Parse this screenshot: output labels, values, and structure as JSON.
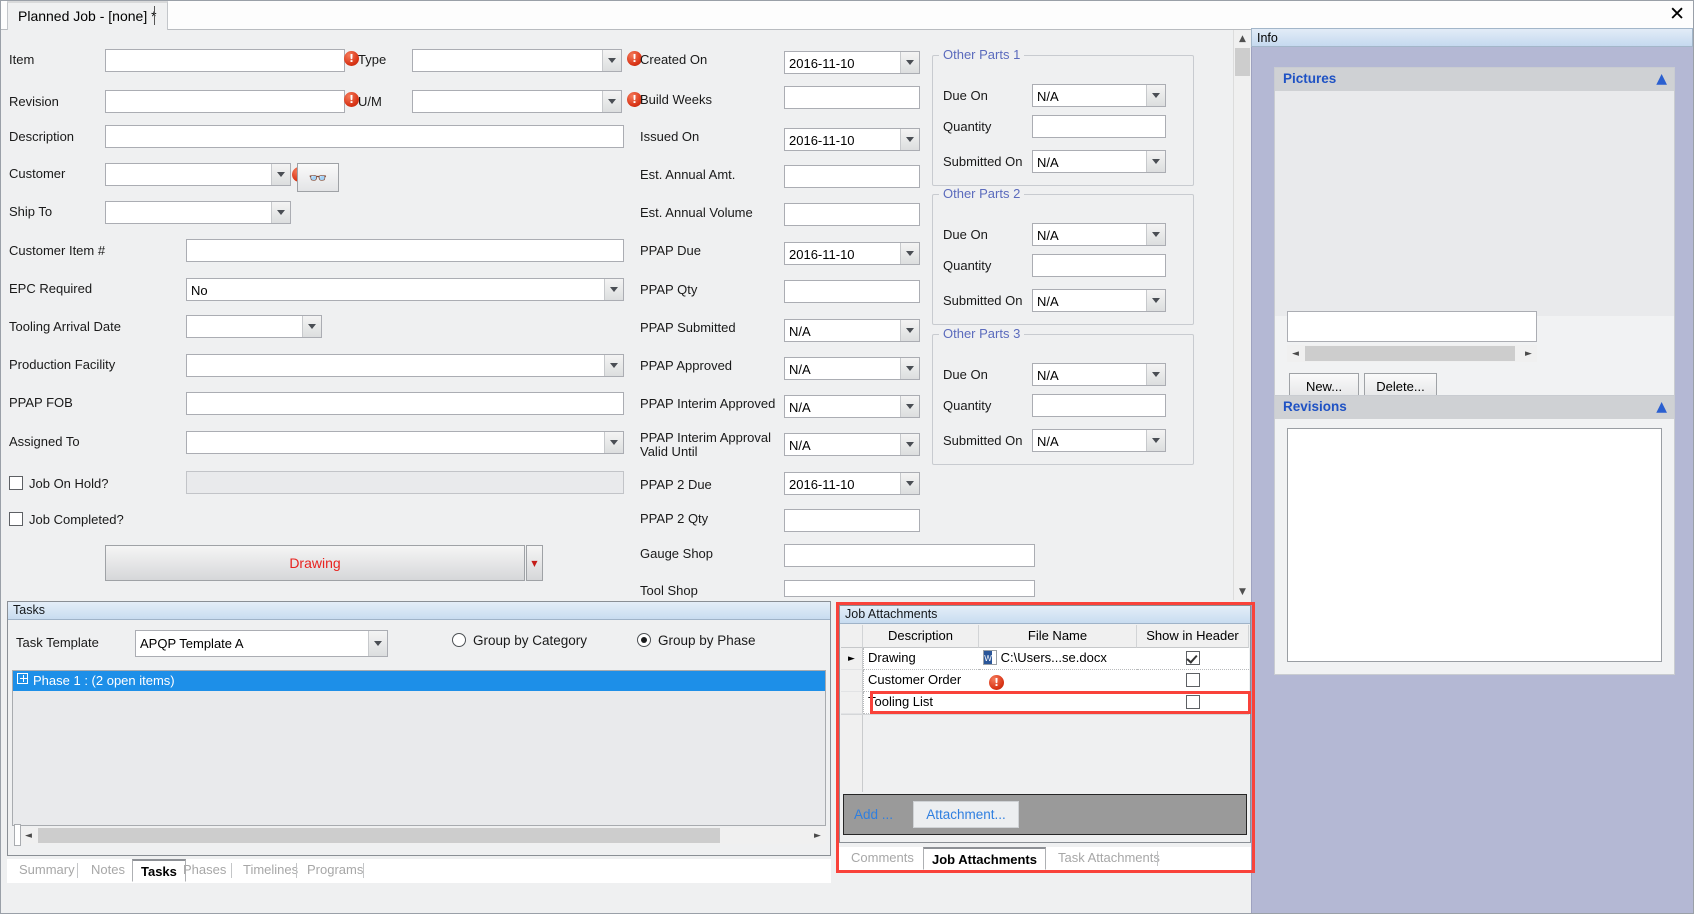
{
  "window": {
    "tab_title": "Planned Job - [none] *",
    "close_icon": "close-icon"
  },
  "left_form": {
    "fields": [
      {
        "label": "Item",
        "value": "",
        "type": "textbox",
        "warn": true,
        "warn_label": "Type"
      },
      {
        "label": "Revision",
        "value": "",
        "type": "textbox",
        "secondary_label": "U/M"
      },
      {
        "label": "Description",
        "value": "",
        "type": "textbox"
      },
      {
        "label": "Customer",
        "value": "",
        "type": "combo"
      },
      {
        "label": "Ship To",
        "value": "",
        "type": "combo"
      },
      {
        "label": "Customer Item #",
        "value": "",
        "type": "textbox"
      },
      {
        "label": "EPC Required",
        "value": "No",
        "type": "combo"
      },
      {
        "label": "Tooling Arrival Date",
        "value": "",
        "type": "combo"
      },
      {
        "label": "Production Facility",
        "value": "",
        "type": "combo"
      },
      {
        "label": "PPAP FOB",
        "value": "",
        "type": "textbox"
      },
      {
        "label": "Assigned To",
        "value": "",
        "type": "combo"
      }
    ],
    "type_field_value": "",
    "um_field_value": "",
    "search_button_icon": "binoculars-icon",
    "checkboxes": [
      {
        "label": "Job On Hold?",
        "checked": false
      },
      {
        "label": "Job Completed?",
        "checked": false
      }
    ],
    "hold_note_value": "",
    "drawing_button": {
      "label": "Drawing",
      "color": "#e8231f",
      "dropdown_icon": "chevron-down-icon"
    }
  },
  "mid_form": {
    "fields": [
      {
        "label": "Created On",
        "value": "2016-11-10",
        "type": "combo",
        "warn": true
      },
      {
        "label": "Build Weeks",
        "value": "",
        "type": "textbox",
        "warn": true
      },
      {
        "label": "Issued On",
        "value": "2016-11-10",
        "type": "combo"
      },
      {
        "label": "Est. Annual Amt.",
        "value": "",
        "type": "textbox"
      },
      {
        "label": "Est. Annual Volume",
        "value": "",
        "type": "textbox"
      },
      {
        "label": "PPAP Due",
        "value": "2016-11-10",
        "type": "combo"
      },
      {
        "label": "PPAP Qty",
        "value": "",
        "type": "textbox"
      },
      {
        "label": "PPAP Submitted",
        "value": "N/A",
        "type": "combo"
      },
      {
        "label": "PPAP Approved",
        "value": "N/A",
        "type": "combo"
      },
      {
        "label": "PPAP Interim Approved",
        "value": "N/A",
        "type": "combo"
      },
      {
        "label": "PPAP Interim Approval Valid Until",
        "value": "N/A",
        "type": "combo"
      },
      {
        "label": "PPAP 2 Due",
        "value": "2016-11-10",
        "type": "combo"
      },
      {
        "label": "PPAP 2 Qty",
        "value": "",
        "type": "textbox"
      },
      {
        "label": "Gauge Shop",
        "value": "",
        "type": "textbox"
      },
      {
        "label": "Tool Shop",
        "value": "",
        "type": "textbox"
      }
    ]
  },
  "other_parts": [
    {
      "title": "Other Parts 1",
      "rows": [
        {
          "label": "Due On",
          "value": "N/A",
          "type": "combo"
        },
        {
          "label": "Quantity",
          "value": "",
          "type": "textbox"
        },
        {
          "label": "Submitted On",
          "value": "N/A",
          "type": "combo"
        }
      ]
    },
    {
      "title": "Other Parts 2",
      "rows": [
        {
          "label": "Due On",
          "value": "N/A",
          "type": "combo"
        },
        {
          "label": "Quantity",
          "value": "",
          "type": "textbox"
        },
        {
          "label": "Submitted On",
          "value": "N/A",
          "type": "combo"
        }
      ]
    },
    {
      "title": "Other Parts 3",
      "rows": [
        {
          "label": "Due On",
          "value": "N/A",
          "type": "combo"
        },
        {
          "label": "Quantity",
          "value": "",
          "type": "textbox"
        },
        {
          "label": "Submitted On",
          "value": "N/A",
          "type": "combo"
        }
      ]
    }
  ],
  "info_panel": {
    "caption": "Info",
    "pictures": {
      "title": "Pictures",
      "collapse_icon": "chevron-up-icon",
      "caption_value": "",
      "nav_prev_icon": "chevron-left-icon",
      "nav_next_icon": "chevron-right-icon",
      "new_button": "New...",
      "delete_button": "Delete..."
    },
    "revisions": {
      "title": "Revisions",
      "collapse_icon": "chevron-up-icon"
    }
  },
  "tasks_panel": {
    "caption": "Tasks",
    "template_label": "Task Template",
    "template_value": "APQP Template A",
    "group_options": [
      {
        "label": "Group by Category",
        "selected": false
      },
      {
        "label": "Group by Phase",
        "selected": true
      }
    ],
    "tree_root": "Phase 1 : (2 open items)",
    "scroll_prev_icon": "chevron-left-icon",
    "scroll_next_icon": "chevron-right-icon"
  },
  "left_tabs": [
    {
      "label": "Summary",
      "active": false
    },
    {
      "label": "Notes",
      "active": false
    },
    {
      "label": "Tasks",
      "active": true
    },
    {
      "label": "Phases",
      "active": false
    },
    {
      "label": "Timelines",
      "active": false
    },
    {
      "label": "Programs",
      "active": false
    }
  ],
  "attachments_panel": {
    "caption": "Job Attachments",
    "columns": [
      "Description",
      "File Name",
      "Show in Header"
    ],
    "rows": [
      {
        "selected": true,
        "description": "Drawing",
        "file_name": "C:\\Users...se.docx",
        "file_icon": "word-document-icon",
        "has_warning": false,
        "show_in_header": true,
        "highlighted": false
      },
      {
        "selected": false,
        "description": "Customer Order",
        "file_name": "",
        "file_icon": "",
        "has_warning": true,
        "show_in_header": false,
        "highlighted": false
      },
      {
        "selected": false,
        "description": "Tooling List",
        "file_name": "",
        "file_icon": "",
        "has_warning": false,
        "show_in_header": false,
        "highlighted": true
      }
    ],
    "toolbar": {
      "add_label": "Add ...",
      "attachment_label": "Attachment..."
    },
    "tabs": [
      {
        "label": "Comments",
        "active": false
      },
      {
        "label": "Job Attachments",
        "active": true
      },
      {
        "label": "Task Attachments",
        "active": false
      }
    ]
  },
  "colors": {
    "accent_blue": "#1d8fe8",
    "group_title": "#5b6bbd",
    "panel_header_text": "#1f52c4",
    "highlight_red": "#f9423a",
    "drawing_red": "#e8231f",
    "link_blue": "#2f7fe0"
  }
}
